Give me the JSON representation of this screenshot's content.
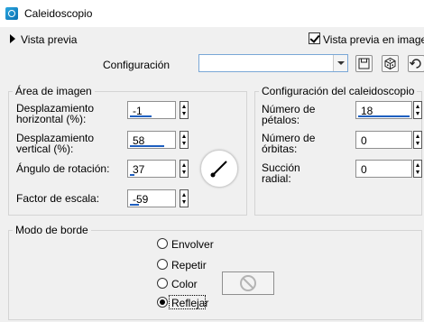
{
  "window": {
    "title": "Caleidoscopio"
  },
  "preview": {
    "label": "Vista previa",
    "live_label": "Vista previa en imagen",
    "live_checked": true
  },
  "config": {
    "label": "Configuración",
    "value": ""
  },
  "image_area": {
    "title": "Área de imagen",
    "h_offset": {
      "label1": "Desplazamiento",
      "label2": "horizontal (%):",
      "value": "-1",
      "fill": 0.5
    },
    "v_offset": {
      "label1": "Desplazamiento",
      "label2": "vertical (%):",
      "value": "58",
      "fill": 0.79
    },
    "rotation": {
      "label": "Ángulo de rotación:",
      "value": "37",
      "fill": 0.1
    },
    "scale": {
      "label": "Factor de escala:",
      "value": "-59",
      "fill": 0.2
    }
  },
  "kaleido": {
    "title": "Configuración del caleidoscopio",
    "petals": {
      "label1": "Número de",
      "label2": "pétalos:",
      "value": "18",
      "fill": 1.0
    },
    "orbits": {
      "label1": "Número de",
      "label2": "órbitas:",
      "value": "0",
      "fill": 0.0
    },
    "suction": {
      "label1": "Succión",
      "label2": "radial:",
      "value": "0",
      "fill": 0.0
    }
  },
  "edge_mode": {
    "title": "Modo de borde",
    "options": [
      "Envolver",
      "Repetir",
      "Color",
      "Reflejar"
    ],
    "selected": "Reflejar"
  },
  "colors": {
    "accent": "#1e5fc0",
    "icon_blue": "#2aa7e0"
  }
}
